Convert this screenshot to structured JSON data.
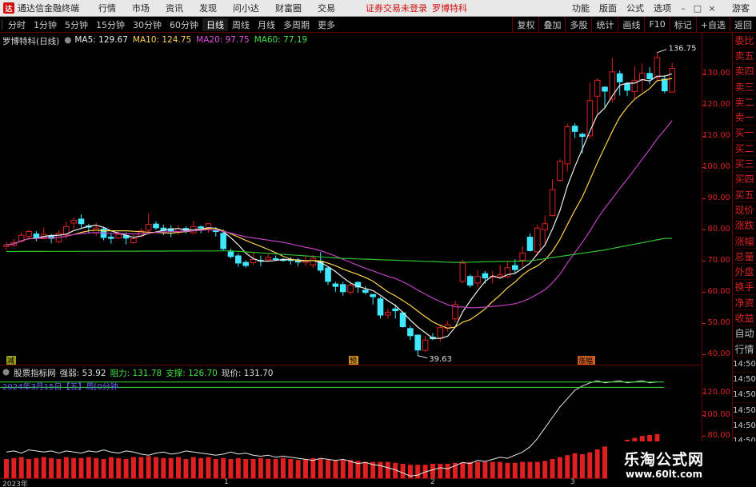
{
  "menubar": {
    "app_title": "通达信金融终端",
    "logo_glyph": "达",
    "menus": [
      "行情",
      "市场",
      "资讯",
      "发现",
      "问小达",
      "财富圈",
      "交易"
    ],
    "notice": "证券交易未登录",
    "stock": "罗博特科",
    "right_menus": [
      "功能",
      "版面",
      "公式",
      "选项"
    ],
    "guest": "游客"
  },
  "toolbar": {
    "periods": [
      "分时",
      "1分钟",
      "5分钟",
      "15分钟",
      "30分钟",
      "60分钟",
      "日线",
      "周线",
      "月线",
      "多周期",
      "更多"
    ],
    "active_period": "日线",
    "tools": [
      "复权",
      "叠加",
      "多股",
      "统计",
      "画线",
      "F10",
      "标记",
      "+自选",
      "返回"
    ]
  },
  "main_legend": {
    "stock_label": "罗博特科(日线)",
    "ma5": "MA5: 129.67",
    "ma10": "MA10: 124.75",
    "ma20": "MA20: 97.75",
    "ma60": "MA60: 77.19"
  },
  "main_axis": {
    "ticks": [
      "130.00",
      "120.00",
      "110.00",
      "100.00",
      "90.00",
      "80.00",
      "70.00",
      "60.00",
      "50.00",
      "40.00"
    ],
    "ticks_values": [
      130,
      120,
      110,
      100,
      90,
      80,
      70,
      60,
      50,
      40
    ]
  },
  "annotations": {
    "high_label": "136.75",
    "low_label": "39.63",
    "marker_left": "减",
    "marker_mid": "预",
    "marker_right": "涨幅"
  },
  "indicator": {
    "title": "股票指标网",
    "volume": "强弱: 53.92",
    "resistance": "阻力: 131.78",
    "support": "支撑: 126.70",
    "current": "现价: 131.70",
    "date_line": "2024年3月15日【五】周[0分钟",
    "axis_ticks": [
      "120.00",
      "100.00",
      "80.00"
    ]
  },
  "time_axis": {
    "labels": [
      "2023年",
      "1",
      "2",
      "3"
    ]
  },
  "sidebar": {
    "items": [
      "委比",
      "卖五",
      "卖四",
      "卖三",
      "卖二",
      "卖一",
      "买一",
      "买二",
      "买三",
      "买四",
      "买五",
      "现价",
      "涨跌",
      "涨幅",
      "总量",
      "外盘",
      "换手",
      "净资",
      "收益",
      "自动",
      "行情"
    ],
    "times": [
      "14:50",
      "14:50",
      "14:50",
      "14:50",
      "14:50",
      "14:50",
      "14:50",
      "14:50"
    ]
  },
  "watermark": {
    "main": "乐淘公式网",
    "url": "www.60lt.com"
  },
  "colors": {
    "up": "#e02020",
    "down": "#40e8ff",
    "ma5": "#eeeeee",
    "ma10": "#ffd24a",
    "ma20": "#c040c0",
    "ma60": "#30c030",
    "axis": "#d22222"
  },
  "chart_data": {
    "type": "candlestick",
    "candles": [
      {
        "o": 74.6,
        "c": 75.1,
        "h": 76.0,
        "l": 73.4
      },
      {
        "o": 75.0,
        "c": 75.9,
        "h": 77.0,
        "l": 74.5
      },
      {
        "o": 76.3,
        "c": 78.2,
        "h": 79.1,
        "l": 75.9
      },
      {
        "o": 77.9,
        "c": 79.4,
        "h": 80.0,
        "l": 76.7
      },
      {
        "o": 78.6,
        "c": 77.3,
        "h": 79.5,
        "l": 76.3
      },
      {
        "o": 77.1,
        "c": 78.5,
        "h": 80.7,
        "l": 76.9
      },
      {
        "o": 78.0,
        "c": 77.2,
        "h": 78.6,
        "l": 75.6
      },
      {
        "o": 76.1,
        "c": 78.8,
        "h": 79.7,
        "l": 75.6
      },
      {
        "o": 78.3,
        "c": 81.0,
        "h": 82.6,
        "l": 77.0
      },
      {
        "o": 82.1,
        "c": 83.0,
        "h": 83.9,
        "l": 80.2
      },
      {
        "o": 83.4,
        "c": 81.9,
        "h": 84.9,
        "l": 80.3
      },
      {
        "o": 81.2,
        "c": 80.8,
        "h": 81.9,
        "l": 78.8
      },
      {
        "o": 79.0,
        "c": 80.5,
        "h": 82.2,
        "l": 78.0
      },
      {
        "o": 80.2,
        "c": 77.5,
        "h": 80.9,
        "l": 76.6
      },
      {
        "o": 77.6,
        "c": 77.2,
        "h": 78.6,
        "l": 75.5
      },
      {
        "o": 77.3,
        "c": 78.5,
        "h": 79.8,
        "l": 77.0
      },
      {
        "o": 78.1,
        "c": 77.3,
        "h": 79.1,
        "l": 75.3
      },
      {
        "o": 75.8,
        "c": 77.1,
        "h": 78.3,
        "l": 75.4
      },
      {
        "o": 78.0,
        "c": 79.6,
        "h": 80.5,
        "l": 77.6
      },
      {
        "o": 79.8,
        "c": 81.7,
        "h": 85.2,
        "l": 78.4
      },
      {
        "o": 81.8,
        "c": 80.6,
        "h": 82.6,
        "l": 79.9
      },
      {
        "o": 80.5,
        "c": 79.7,
        "h": 81.6,
        "l": 78.2
      },
      {
        "o": 80.3,
        "c": 79.5,
        "h": 81.4,
        "l": 77.6
      },
      {
        "o": 79.4,
        "c": 80.3,
        "h": 81.5,
        "l": 78.4
      },
      {
        "o": 80.4,
        "c": 79.4,
        "h": 81.1,
        "l": 78.8
      },
      {
        "o": 79.0,
        "c": 81.0,
        "h": 82.7,
        "l": 78.7
      },
      {
        "o": 80.9,
        "c": 80.5,
        "h": 81.4,
        "l": 78.8
      },
      {
        "o": 80.6,
        "c": 81.9,
        "h": 82.0,
        "l": 79.0
      },
      {
        "o": 79.9,
        "c": 79.4,
        "h": 80.8,
        "l": 77.8
      },
      {
        "o": 78.8,
        "c": 73.9,
        "h": 80.0,
        "l": 73.4
      },
      {
        "o": 72.9,
        "c": 71.4,
        "h": 73.9,
        "l": 70.8
      },
      {
        "o": 71.6,
        "c": 69.3,
        "h": 72.4,
        "l": 68.1
      },
      {
        "o": 69.5,
        "c": 68.5,
        "h": 70.2,
        "l": 67.8
      },
      {
        "o": 69.4,
        "c": 70.5,
        "h": 72.6,
        "l": 68.8
      },
      {
        "o": 70.2,
        "c": 69.9,
        "h": 71.7,
        "l": 68.2
      },
      {
        "o": 70.3,
        "c": 71.1,
        "h": 72.1,
        "l": 69.9
      },
      {
        "o": 70.7,
        "c": 70.6,
        "h": 71.7,
        "l": 70.1
      },
      {
        "o": 70.5,
        "c": 70.1,
        "h": 70.9,
        "l": 69.8
      },
      {
        "o": 70.5,
        "c": 70.1,
        "h": 71.2,
        "l": 68.8
      },
      {
        "o": 70.2,
        "c": 69.6,
        "h": 70.9,
        "l": 68.3
      },
      {
        "o": 69.5,
        "c": 69.9,
        "h": 71.6,
        "l": 68.3
      },
      {
        "o": 68.7,
        "c": 70.8,
        "h": 71.8,
        "l": 67.7
      },
      {
        "o": 69.9,
        "c": 67.0,
        "h": 72.8,
        "l": 66.1
      },
      {
        "o": 67.7,
        "c": 63.4,
        "h": 68.1,
        "l": 62.3
      },
      {
        "o": 62.6,
        "c": 61.8,
        "h": 63.3,
        "l": 60.1
      },
      {
        "o": 62.4,
        "c": 60.1,
        "h": 63.3,
        "l": 58.8
      },
      {
        "o": 60.0,
        "c": 62.2,
        "h": 63.3,
        "l": 59.1
      },
      {
        "o": 63.1,
        "c": 61.6,
        "h": 63.4,
        "l": 59.8
      },
      {
        "o": 60.6,
        "c": 59.9,
        "h": 61.9,
        "l": 59.2
      },
      {
        "o": 59.2,
        "c": 58.5,
        "h": 59.4,
        "l": 56.0
      },
      {
        "o": 57.8,
        "c": 52.6,
        "h": 58.5,
        "l": 51.5
      },
      {
        "o": 52.6,
        "c": 53.5,
        "h": 54.6,
        "l": 51.5
      },
      {
        "o": 54.6,
        "c": 54.0,
        "h": 56.1,
        "l": 51.5
      },
      {
        "o": 53.3,
        "c": 48.9,
        "h": 53.7,
        "l": 48.6
      },
      {
        "o": 48.3,
        "c": 46.0,
        "h": 49.2,
        "l": 44.6
      },
      {
        "o": 46.2,
        "c": 41.4,
        "h": 46.4,
        "l": 39.6
      },
      {
        "o": 41.3,
        "c": 44.6,
        "h": 45.8,
        "l": 40.7
      },
      {
        "o": 45.5,
        "c": 45.0,
        "h": 46.8,
        "l": 44.6
      },
      {
        "o": 45.1,
        "c": 48.6,
        "h": 49.7,
        "l": 44.2
      },
      {
        "o": 48.4,
        "c": 49.5,
        "h": 50.7,
        "l": 47.3
      },
      {
        "o": 51.4,
        "c": 56.0,
        "h": 57.2,
        "l": 50.2
      },
      {
        "o": 63.4,
        "c": 69.3,
        "h": 70.3,
        "l": 62.8
      },
      {
        "o": 65.0,
        "c": 62.2,
        "h": 65.6,
        "l": 61.5
      },
      {
        "o": 62.9,
        "c": 65.0,
        "h": 67.0,
        "l": 61.6
      },
      {
        "o": 65.9,
        "c": 64.5,
        "h": 66.7,
        "l": 62.7
      },
      {
        "o": 64.8,
        "c": 65.0,
        "h": 66.7,
        "l": 62.8
      },
      {
        "o": 64.9,
        "c": 65.5,
        "h": 68.6,
        "l": 64.4
      },
      {
        "o": 64.9,
        "c": 67.8,
        "h": 69.7,
        "l": 64.5
      },
      {
        "o": 68.5,
        "c": 67.2,
        "h": 70.5,
        "l": 65.8
      },
      {
        "o": 70.2,
        "c": 72.5,
        "h": 74.7,
        "l": 67.8
      },
      {
        "o": 77.6,
        "c": 73.3,
        "h": 78.8,
        "l": 73.0
      },
      {
        "o": 72.9,
        "c": 80.5,
        "h": 81.6,
        "l": 71.7
      },
      {
        "o": 80.0,
        "c": 81.9,
        "h": 84.6,
        "l": 75.5
      },
      {
        "o": 84.5,
        "c": 92.8,
        "h": 96.1,
        "l": 84.4
      },
      {
        "o": 95.8,
        "c": 101.9,
        "h": 102.6,
        "l": 95.3
      },
      {
        "o": 101.1,
        "c": 113.0,
        "h": 113.9,
        "l": 98.7
      },
      {
        "o": 113.2,
        "c": 111.5,
        "h": 114.1,
        "l": 109.4
      },
      {
        "o": 110.6,
        "c": 109.9,
        "h": 111.1,
        "l": 104.4
      },
      {
        "o": 110.1,
        "c": 121.4,
        "h": 127.1,
        "l": 109.3
      },
      {
        "o": 122.8,
        "c": 127.9,
        "h": 128.5,
        "l": 116.9
      },
      {
        "o": 125.7,
        "c": 124.4,
        "h": 126.0,
        "l": 119.1
      },
      {
        "o": 121.9,
        "c": 130.6,
        "h": 135.1,
        "l": 120.8
      },
      {
        "o": 130.0,
        "c": 127.4,
        "h": 131.0,
        "l": 123.0
      },
      {
        "o": 126.7,
        "c": 124.7,
        "h": 127.1,
        "l": 122.8
      },
      {
        "o": 124.3,
        "c": 127.8,
        "h": 132.4,
        "l": 121.8
      },
      {
        "o": 128.1,
        "c": 130.1,
        "h": 133.3,
        "l": 124.2
      },
      {
        "o": 130.1,
        "c": 128.4,
        "h": 132.1,
        "l": 126.6
      },
      {
        "o": 128.8,
        "c": 135.2,
        "h": 136.8,
        "l": 127.5
      },
      {
        "o": 128.3,
        "c": 124.5,
        "h": 129.6,
        "l": 123.8
      },
      {
        "o": 124.1,
        "c": 131.7,
        "h": 133.5,
        "l": 124.1
      }
    ],
    "ma60_anchor": [
      [
        0,
        73.0
      ],
      [
        30,
        73.2
      ],
      [
        45,
        70.8
      ],
      [
        60,
        69.5
      ],
      [
        70,
        70.0
      ],
      [
        80,
        73.5
      ],
      [
        88,
        77.2
      ]
    ],
    "ylim": [
      38,
      138
    ],
    "indicator": {
      "volume_bars": [
        20,
        21,
        22,
        20,
        21,
        22,
        21,
        20,
        22,
        21,
        21,
        22,
        21,
        20,
        22,
        21,
        20,
        22,
        22,
        23,
        22,
        21,
        21,
        22,
        20,
        22,
        21,
        22,
        20,
        21,
        20,
        21,
        20,
        20,
        21,
        20,
        20,
        21,
        20,
        19,
        20,
        21,
        20,
        19,
        19,
        19,
        19,
        18,
        17,
        17,
        17,
        17,
        16,
        15,
        14,
        14,
        14,
        15,
        15,
        15,
        16,
        16,
        17,
        17,
        17,
        17,
        17,
        16,
        16,
        17,
        17,
        17,
        18,
        20,
        22,
        24,
        26,
        25,
        27,
        30,
        33,
        35,
        37,
        40,
        42,
        44,
        45,
        46
      ],
      "line": [
        65,
        66,
        64,
        67,
        66,
        65,
        66,
        64,
        66,
        65,
        64,
        66,
        65,
        67,
        65,
        64,
        66,
        65,
        63,
        62,
        64,
        65,
        63,
        64,
        66,
        65,
        64,
        63,
        62,
        63,
        65,
        63,
        64,
        62,
        61,
        62,
        60,
        61,
        60,
        59,
        58,
        57,
        59,
        58,
        57,
        58,
        56,
        54,
        55,
        53,
        52,
        50,
        48,
        45,
        42,
        43,
        46,
        48,
        50,
        49,
        52,
        55,
        54,
        57,
        56,
        58,
        60,
        59,
        62,
        65,
        70,
        78,
        88,
        98,
        108,
        116,
        124,
        128,
        131,
        133,
        131,
        132,
        133,
        131,
        132,
        133,
        131,
        132
      ],
      "resistance": 131.78,
      "support": 126.7
    }
  }
}
